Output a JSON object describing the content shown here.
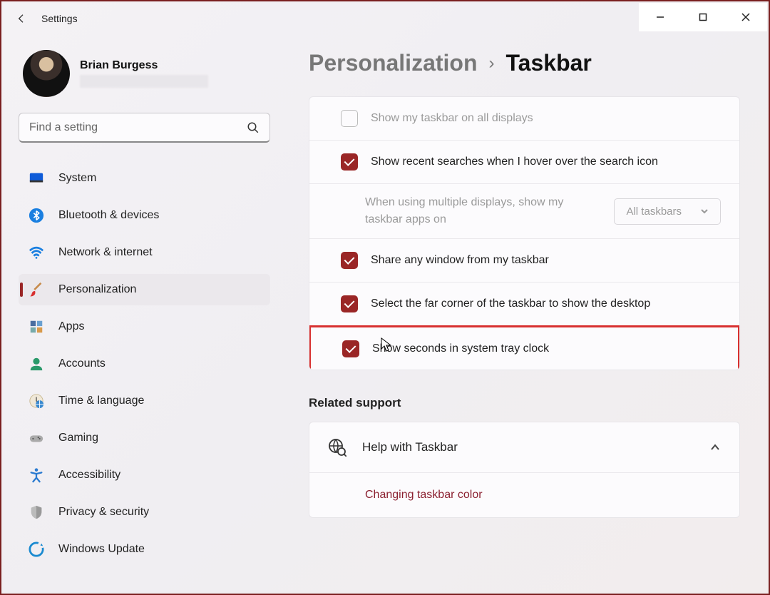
{
  "app": {
    "title": "Settings"
  },
  "profile": {
    "name": "Brian Burgess"
  },
  "search": {
    "placeholder": "Find a setting"
  },
  "sidebar": {
    "items": [
      {
        "label": "System"
      },
      {
        "label": "Bluetooth & devices"
      },
      {
        "label": "Network & internet"
      },
      {
        "label": "Personalization"
      },
      {
        "label": "Apps"
      },
      {
        "label": "Accounts"
      },
      {
        "label": "Time & language"
      },
      {
        "label": "Gaming"
      },
      {
        "label": "Accessibility"
      },
      {
        "label": "Privacy & security"
      },
      {
        "label": "Windows Update"
      }
    ]
  },
  "breadcrumb": {
    "parent": "Personalization",
    "current": "Taskbar"
  },
  "settings": {
    "show_all_displays": "Show my taskbar on all displays",
    "recent_searches": "Show recent searches when I hover over the search icon",
    "multi_display_label": "When using multiple displays, show my taskbar apps on",
    "multi_display_value": "All taskbars",
    "share_window": "Share any window from my taskbar",
    "far_corner": "Select the far corner of the taskbar to show the desktop",
    "show_seconds": "Show seconds in system tray clock"
  },
  "related": {
    "title": "Related support",
    "help_title": "Help with Taskbar",
    "link1": "Changing taskbar color"
  }
}
